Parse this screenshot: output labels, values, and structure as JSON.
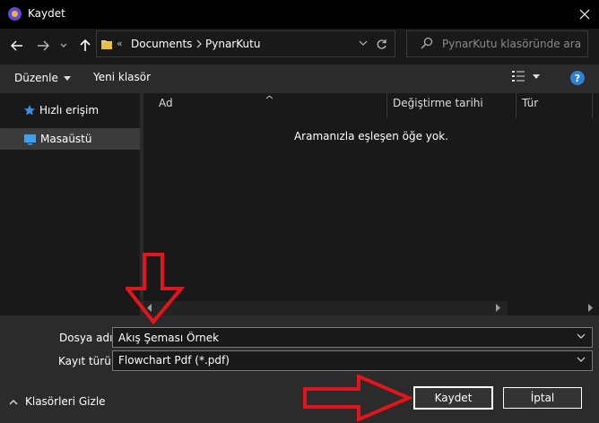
{
  "window": {
    "title": "Kaydet"
  },
  "nav": {
    "breadcrumb_overflow": "«",
    "breadcrumb": [
      "Documents",
      "PynarKutu"
    ],
    "search_placeholder": "PynarKutu klasöründe ara"
  },
  "toolbar": {
    "organize_label": "Düzenle",
    "new_folder_label": "Yeni klasör",
    "help_label": "?"
  },
  "navpane": {
    "items": [
      {
        "label": "Hızlı erişim",
        "icon": "star-icon",
        "selected": false
      },
      {
        "label": "Masaüstü",
        "icon": "desktop-icon",
        "selected": true
      }
    ]
  },
  "filelist": {
    "columns": [
      "Ad",
      "Değiştirme tarihi",
      "Tür"
    ],
    "empty_message": "Aramanızla eşleşen öğe yok."
  },
  "form": {
    "filename_label": "Dosya adı:",
    "filename_value": "Akış Şeması Örnek",
    "filetype_label": "Kayıt türü:",
    "filetype_value": "Flowchart Pdf (*.pdf)"
  },
  "footer": {
    "hide_folders_label": "Klasörleri Gizle",
    "save_label": "Kaydet",
    "cancel_label": "İptal"
  },
  "colors": {
    "background": "#191919",
    "panel": "#2b2b2b",
    "accent": "#2f7fd3",
    "annotation_red": "#e3141b"
  }
}
